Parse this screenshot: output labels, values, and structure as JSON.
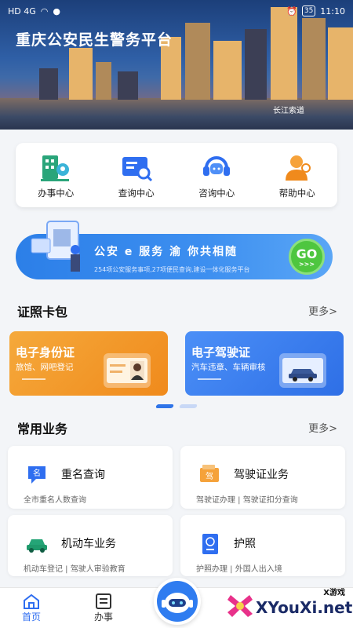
{
  "status_bar": {
    "left_text": "HD 4G",
    "battery": "35",
    "time": "11:10"
  },
  "hero": {
    "title": "重庆公安民生警务平台",
    "caption": "长江索道"
  },
  "quick_menu": [
    {
      "label": "办事中心",
      "icon": "building-pin-icon"
    },
    {
      "label": "查询中心",
      "icon": "id-card-search-icon"
    },
    {
      "label": "咨询中心",
      "icon": "headset-icon"
    },
    {
      "label": "帮助中心",
      "icon": "person-help-icon"
    }
  ],
  "promo": {
    "main": "公安 e 服务  渝  你共相随",
    "sub": "254项公安服务事项,27项便民查询,建设一体化服务平台",
    "go": "GO",
    "go_arrows": ">>>"
  },
  "license_section": {
    "title": "证照卡包",
    "more": "更多>"
  },
  "licenses": [
    {
      "title": "电子身份证",
      "subtitle": "旅馆、网吧登记"
    },
    {
      "title": "电子驾驶证",
      "subtitle": "汽车违章、车辆审核"
    }
  ],
  "business_section": {
    "title": "常用业务",
    "more": "更多>"
  },
  "services": [
    {
      "name": "重名查询",
      "desc": "全市重名人数查询",
      "icon": "name-query-icon"
    },
    {
      "name": "驾驶证业务",
      "desc": "驾驶证办理 | 驾驶证扣分查询",
      "icon": "driver-license-icon"
    },
    {
      "name": "机动车业务",
      "desc": "机动车登记 | 驾驶人审验教育",
      "icon": "car-icon"
    },
    {
      "name": "护照",
      "desc": "护照办理 | 外国人出入境",
      "icon": "passport-icon"
    }
  ],
  "tabbar": {
    "home": "首页",
    "work": "办事"
  },
  "watermark": {
    "tag": "X游戏",
    "site": "XYouXi.net"
  },
  "colors": {
    "accent": "#2f6ef0",
    "orange_card": "#f5a93b",
    "blue_card": "#3d7ff0",
    "go_button": "#4ec63f"
  }
}
